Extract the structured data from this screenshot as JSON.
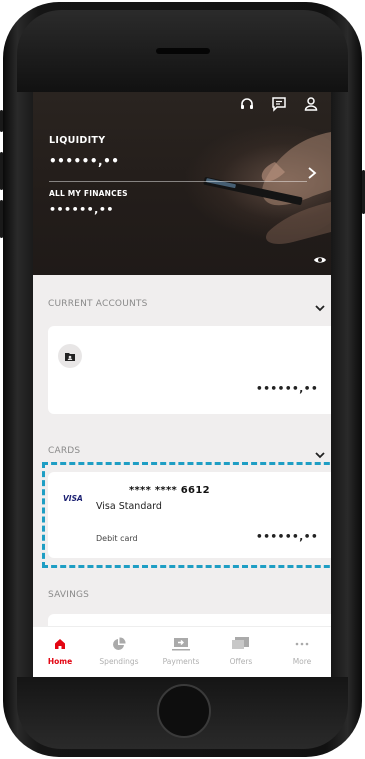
{
  "header": {
    "liquidity_title": "LIQUIDITY",
    "liquidity_value": "••••••,••",
    "finances_title": "ALL MY FINANCES",
    "finances_value": "••••••,••"
  },
  "sections": {
    "current_accounts": {
      "title": "CURRENT ACCOUNTS",
      "masked_balance": "••••••,••"
    },
    "cards": {
      "title": "CARDS",
      "card_brand": "VISA",
      "card_number": "**** **** 6612",
      "card_name": "Visa Standard",
      "card_type": "Debit card",
      "masked_balance": "••••••,••"
    },
    "savings": {
      "title": "SAVINGS"
    }
  },
  "tabbar": {
    "home": "Home",
    "spendings": "Spendings",
    "payments": "Payments",
    "offers": "Offers",
    "more": "More"
  },
  "colors": {
    "accent": "#e30613",
    "highlight": "#1e9ec4",
    "visa_blue": "#1a1f71"
  },
  "icons": {
    "header": [
      "headset-icon",
      "chat-icon",
      "user-icon"
    ],
    "hero": [
      "chevron-right-icon",
      "eye-icon"
    ],
    "tabs": [
      "home-icon",
      "pie-chart-icon",
      "transfer-icon",
      "offers-icon",
      "more-dots-icon"
    ]
  }
}
